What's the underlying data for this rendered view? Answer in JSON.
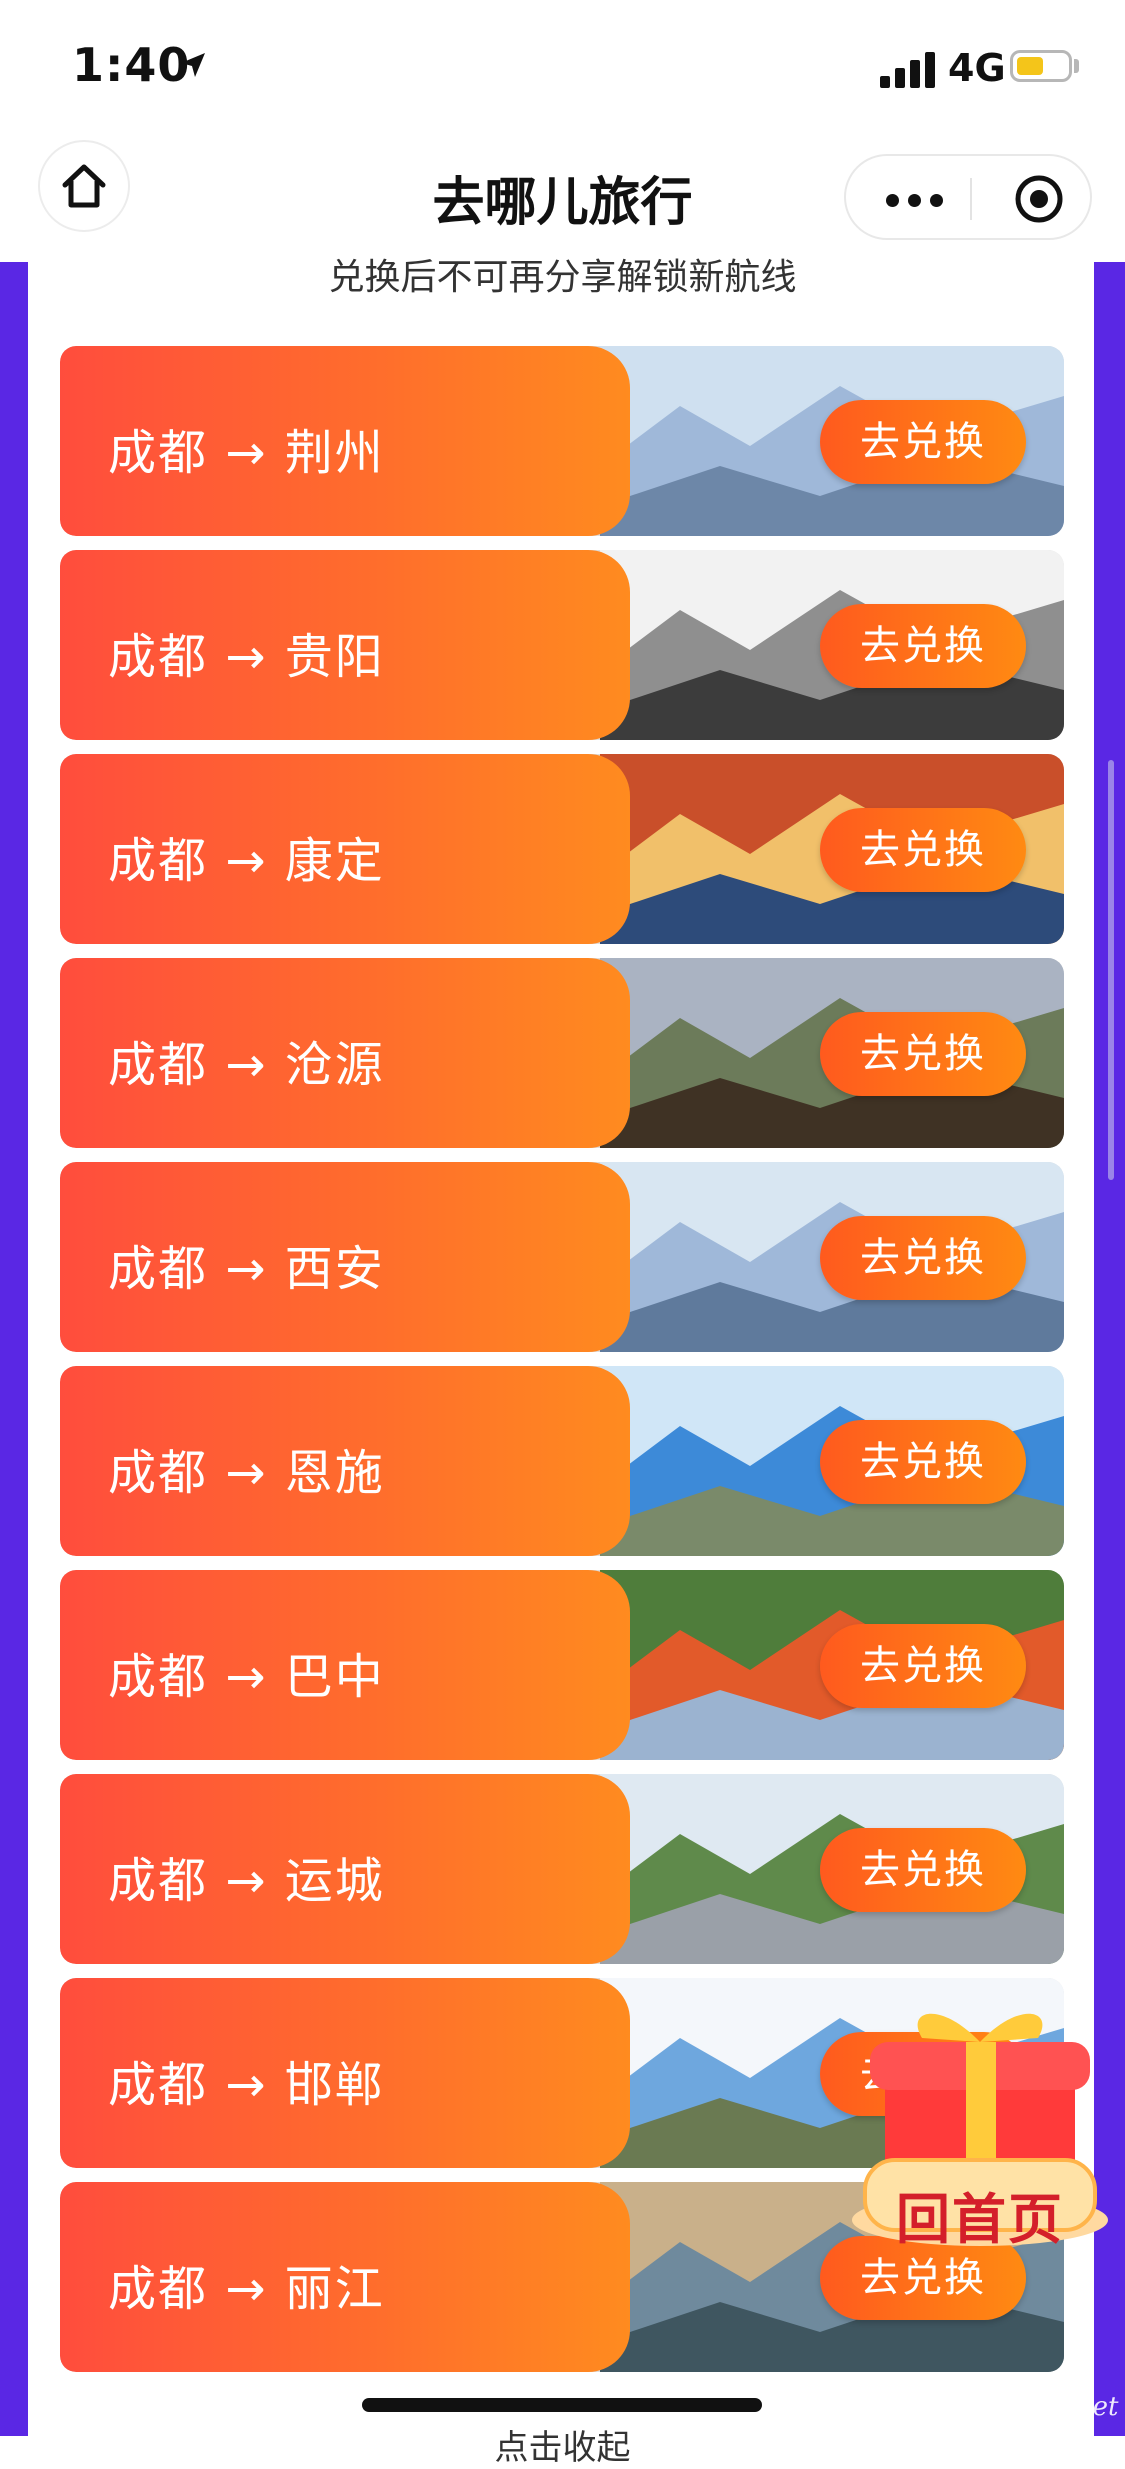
{
  "status_bar": {
    "time": "1:40",
    "network": "4G"
  },
  "nav": {
    "title": "去哪儿旅行",
    "home_icon": "home-icon",
    "more_icon": "more-dots-icon",
    "close_icon": "target-icon"
  },
  "header_note": "兑换后不可再分享解锁新航线",
  "exchange_label": "去兑换",
  "routes": [
    {
      "label": "成都 → 荆州"
    },
    {
      "label": "成都 → 贵阳"
    },
    {
      "label": "成都 → 康定"
    },
    {
      "label": "成都 → 沧源"
    },
    {
      "label": "成都 → 西安"
    },
    {
      "label": "成都 → 恩施"
    },
    {
      "label": "成都 → 巴中"
    },
    {
      "label": "成都 → 运城"
    },
    {
      "label": "成都 → 邯郸"
    },
    {
      "label": "成都 → 丽江"
    }
  ],
  "float_button": {
    "label": "回首页"
  },
  "bottom_hint": "点击收起",
  "watermark": "eLvXing.net",
  "colors": {
    "frame": "#5a27e4",
    "row_gradient_start": "#ff4d3d",
    "row_gradient_end": "#ff8b1f"
  }
}
